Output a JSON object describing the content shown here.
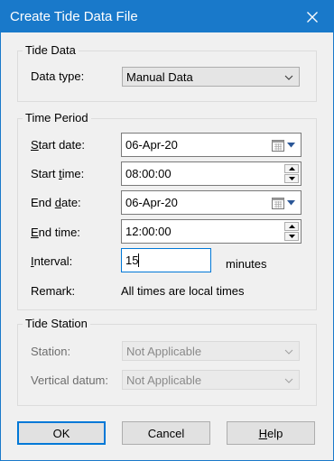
{
  "window": {
    "title": "Create Tide Data File"
  },
  "tide_data": {
    "legend": "Tide Data",
    "data_type_label": "Data type:",
    "data_type_value": "Manual Data"
  },
  "time_period": {
    "legend": "Time Period",
    "start_date_label_u": "S",
    "start_date_label_rest": "tart date:",
    "start_date_value": "06-Apr-20",
    "start_time_label_a": "Start ",
    "start_time_label_u": "t",
    "start_time_label_b": "ime:",
    "start_time_value": "08:00:00",
    "end_date_label_a": "End ",
    "end_date_label_u": "d",
    "end_date_label_b": "ate:",
    "end_date_value": "06-Apr-20",
    "end_time_label_u": "E",
    "end_time_label_rest": "nd time:",
    "end_time_value": "12:00:00",
    "interval_label_u": "I",
    "interval_label_rest": "nterval:",
    "interval_value": "15",
    "interval_unit": "minutes",
    "remark_label": "Remark:",
    "remark_value": "All times are local times"
  },
  "tide_station": {
    "legend": "Tide Station",
    "station_label": "Station:",
    "station_value": "Not Applicable",
    "datum_label": "Vertical datum:",
    "datum_value": "Not Applicable"
  },
  "buttons": {
    "ok": "OK",
    "cancel": "Cancel",
    "help_u": "H",
    "help_rest": "elp"
  },
  "colors": {
    "titlebar": "#1979ca",
    "focus": "#0078d7"
  }
}
